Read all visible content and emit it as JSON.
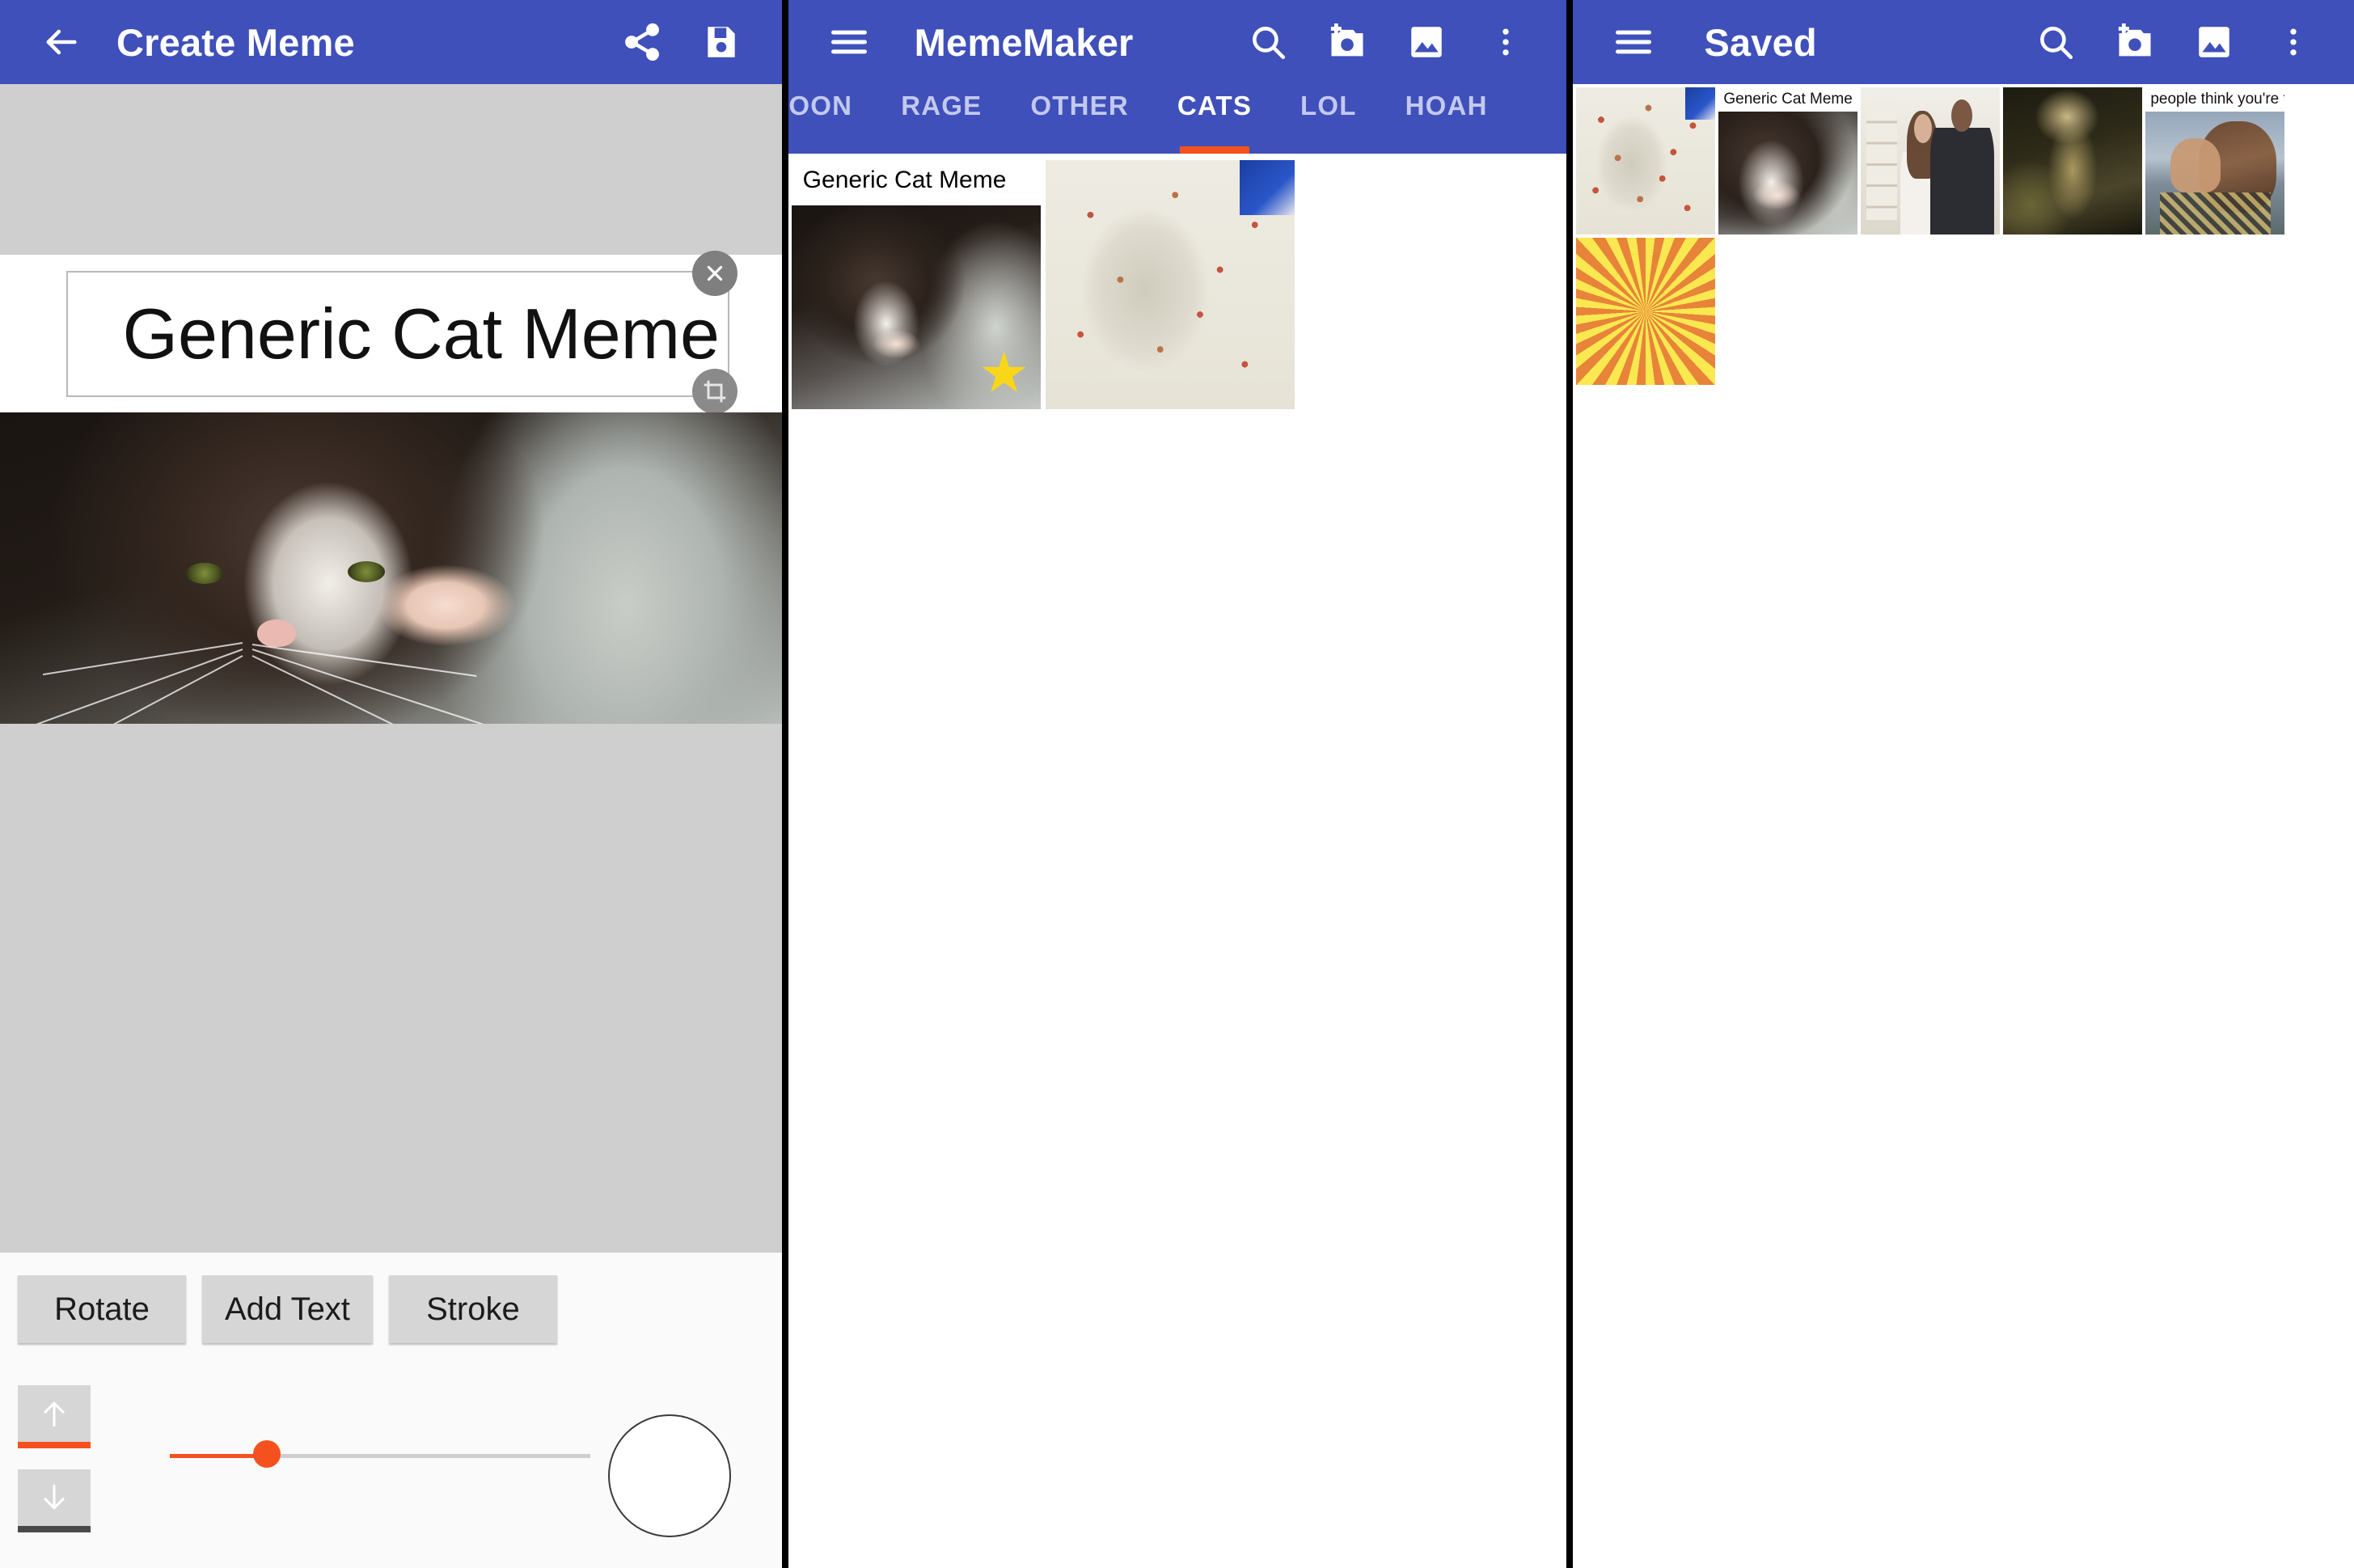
{
  "colors": {
    "appbar_blue": "#3f50ba",
    "accent_orange": "#f4511e",
    "star_yellow": "#f9d617",
    "canvas_gray": "#cfcfcf",
    "button_gray": "#d6d6d6"
  },
  "panel_create": {
    "appbar": {
      "back_icon": "arrow-back-icon",
      "title": "Create Meme",
      "actions": [
        {
          "icon": "share-icon",
          "name": "share-button"
        },
        {
          "icon": "save-icon",
          "name": "save-button"
        }
      ]
    },
    "editor": {
      "meme_text": "Generic Cat Meme",
      "close_handle_icon": "close-icon",
      "crop_handle_icon": "crop-icon",
      "image_alt": "kitten-photo"
    },
    "toolbar": {
      "buttons": [
        {
          "label": "Rotate",
          "name": "rotate-button"
        },
        {
          "label": "Add Text",
          "name": "add-text-button"
        },
        {
          "label": "Stroke",
          "name": "stroke-button"
        }
      ],
      "move_up_icon": "arrow-up-icon",
      "move_down_icon": "arrow-down-icon",
      "size_slider": {
        "value_percent": 23
      },
      "color_swatch": "#ffffff"
    }
  },
  "panel_gallery": {
    "appbar": {
      "menu_icon": "hamburger-menu-icon",
      "title": "MemeMaker",
      "actions": [
        {
          "icon": "search-icon",
          "name": "search-button"
        },
        {
          "icon": "add-photo-camera-icon",
          "name": "camera-button"
        },
        {
          "icon": "image-icon",
          "name": "gallery-button"
        },
        {
          "icon": "overflow-menu-icon",
          "name": "more-options-button"
        }
      ]
    },
    "tabs": [
      {
        "label": "TOON",
        "active": false
      },
      {
        "label": "RAGE",
        "active": false
      },
      {
        "label": "OTHER",
        "active": false
      },
      {
        "label": "CATS",
        "active": true
      },
      {
        "label": "LOL",
        "active": false
      },
      {
        "label": "HOAH",
        "active": false
      }
    ],
    "items": [
      {
        "caption": "Generic Cat Meme",
        "art": "cat-dark",
        "starred": true
      },
      {
        "caption": "",
        "art": "cat-rug",
        "starred": false
      }
    ]
  },
  "panel_saved": {
    "appbar": {
      "menu_icon": "hamburger-menu-icon",
      "title": "Saved",
      "actions": [
        {
          "icon": "search-icon",
          "name": "search-button"
        },
        {
          "icon": "add-photo-camera-icon",
          "name": "camera-button"
        },
        {
          "icon": "image-icon",
          "name": "gallery-button"
        },
        {
          "icon": "overflow-menu-icon",
          "name": "more-options-button"
        }
      ]
    },
    "items": [
      {
        "caption": "",
        "art": "cat-rug"
      },
      {
        "caption": "Generic Cat Meme",
        "art": "cat-dark"
      },
      {
        "caption": "",
        "art": "obama"
      },
      {
        "caption": "",
        "art": "painting"
      },
      {
        "caption": "people think you're the character",
        "art": "drake"
      },
      {
        "caption": "",
        "art": "sunburst"
      }
    ]
  }
}
